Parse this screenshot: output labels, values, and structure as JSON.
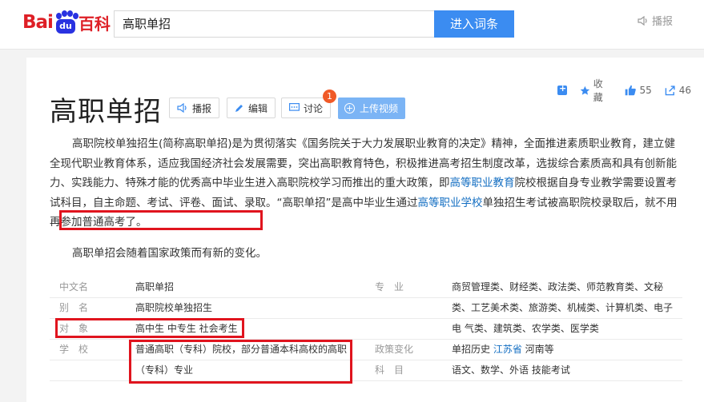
{
  "logo": {
    "bai": "Bai",
    "du": "du",
    "baike": "百科"
  },
  "search": {
    "value": "高职单招",
    "button": "进入词条"
  },
  "header_play": "播报",
  "toolbar_right": {
    "collect": "收藏",
    "likes": "55",
    "share": "46"
  },
  "title": "高职单招",
  "title_buttons": {
    "play": "播报",
    "edit": "编辑",
    "discuss": "讨论",
    "discuss_badge": "1",
    "upload": "上传视频"
  },
  "paragraph": {
    "p1": "高职院校单独招生(简称高职单招)是为贯彻落实《国务院关于大力发展职业教育的决定》精神，全面推进素质职业教育，建立健全现代职业教育体系，适应我国经济社会发展需要，突出高职教育特色，积极推进高考招生制度改革，选拔综合素质高和具有创新能力、实践能力、特殊才能的优秀高中毕业生进入高职院校学习而推出的重大政策，即",
    "link1": "高等职业教育",
    "p2": "院校根据自身专业教学需要设置考试科目，自主命题、考试、评卷、面试、录取。“高职单招”是高中毕业生通过",
    "link2": "高等职业学校",
    "p3": "单独招生考试被高职院校录取后，就不用再参加普通高考了。"
  },
  "paragraph2": "高职单招会随着国家政策而有新的变化。",
  "info": {
    "left": [
      {
        "label": "中文名",
        "value": "高职单招"
      },
      {
        "label": "别　名",
        "value": "高职院校单独招生"
      },
      {
        "label": "对　象",
        "value": "高中生 中专生 社会考生"
      },
      {
        "label": "学　校",
        "value": "普通高职（专科）院校，部分普通本科高校的高职"
      },
      {
        "label": "",
        "value": "（专科）专业"
      }
    ],
    "right": [
      {
        "label": "专　业",
        "value": "商贸管理类、财经类、政法类、师范教育类、文秘"
      },
      {
        "label": "",
        "value": "类、工艺美术类、旅游类、机械类、计算机类、电子"
      },
      {
        "label": "",
        "value": "电 气类、建筑类、农学类、医学类"
      },
      {
        "label": "政策变化",
        "value_pre": "单招历史 ",
        "value_link": "江苏省",
        "value_post": " 河南等"
      },
      {
        "label": "科　目",
        "value": "语文、数学、外语 技能考试"
      }
    ]
  },
  "colors": {
    "brand_red": "#de1f26",
    "brand_blue": "#2932e1",
    "accent": "#3b8cf1",
    "link": "#136ec2",
    "highlight": "#e0141e",
    "badge": "#f05a28"
  }
}
